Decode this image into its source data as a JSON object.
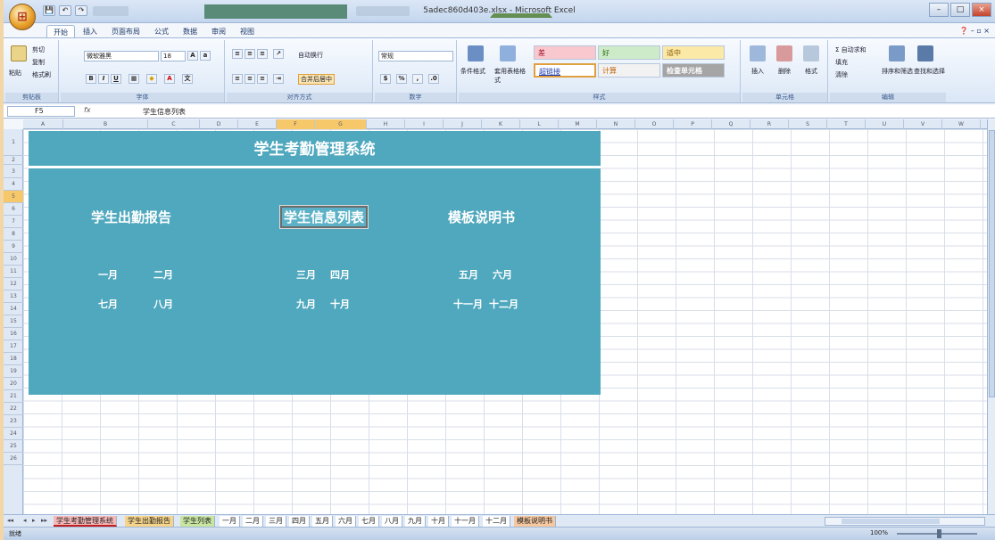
{
  "window": {
    "doc_title": "5adec860d403e.xlsx - Microsoft Excel",
    "controls": [
      "–",
      "□",
      "×"
    ]
  },
  "qat": [
    "💾",
    "↶",
    "↷"
  ],
  "ribbon_tabs": [
    "开始",
    "插入",
    "页面布局",
    "公式",
    "数据",
    "审阅",
    "视图"
  ],
  "ribbon": {
    "clipboard": {
      "label": "剪贴板",
      "paste": "粘贴",
      "cut": "剪切",
      "copy": "复制",
      "format_painter": "格式刷"
    },
    "font": {
      "label": "字体",
      "font_name": "微软雅黑",
      "font_size": "18",
      "bold": "B",
      "italic": "I",
      "underline": "U"
    },
    "alignment": {
      "label": "对齐方式",
      "wrap": "自动换行",
      "merge": "合并后居中"
    },
    "number": {
      "label": "数字",
      "format": "常规"
    },
    "styles": {
      "label": "样式",
      "conditional": "条件格式",
      "table": "套用表格格式",
      "bad": "差",
      "good": "好",
      "neutral": "适中",
      "hyperlink": "超链接",
      "calc": "计算",
      "check": "检查单元格"
    },
    "cells": {
      "label": "单元格",
      "insert": "插入",
      "delete": "删除",
      "format": "格式"
    },
    "editing": {
      "label": "编辑",
      "autosum": "自动求和",
      "fill": "填充",
      "clear": "清除",
      "sort": "排序和筛选",
      "find": "查找和选择"
    }
  },
  "formula_bar": {
    "name_box": "F5",
    "fx": "fx",
    "content": "学生信息列表"
  },
  "columns": [
    "A",
    "B",
    "C",
    "D",
    "E",
    "F",
    "G",
    "H",
    "I",
    "J",
    "K",
    "L",
    "M",
    "N",
    "O",
    "P",
    "Q",
    "R",
    "S",
    "T",
    "U",
    "V",
    "W"
  ],
  "rows": [
    "1",
    "2",
    "3",
    "4",
    "5",
    "6",
    "7",
    "8",
    "9",
    "10",
    "11",
    "12",
    "13",
    "14",
    "15",
    "16",
    "17",
    "18",
    "19",
    "20",
    "21",
    "22",
    "23",
    "24",
    "25",
    "26"
  ],
  "panel": {
    "title": "学生考勤管理系统",
    "links": [
      "学生出勤报告",
      "学生信息列表",
      "模板说明书"
    ],
    "months_row1": [
      "一月",
      "二月",
      "三月",
      "四月",
      "五月",
      "六月"
    ],
    "months_row2": [
      "七月",
      "八月",
      "九月",
      "十月",
      "十一月",
      "十二月"
    ]
  },
  "sheet_tabs": [
    "学生考勤管理系统",
    "学生出勤报告",
    "学生列表",
    "一月",
    "二月",
    "三月",
    "四月",
    "五月",
    "六月",
    "七月",
    "八月",
    "九月",
    "十月",
    "十一月",
    "十二月",
    "模板说明书"
  ],
  "status": {
    "ready": "就绪",
    "zoom": "100%"
  },
  "colors": {
    "panel": "#4fa8be",
    "selection": "#f6c86a"
  }
}
